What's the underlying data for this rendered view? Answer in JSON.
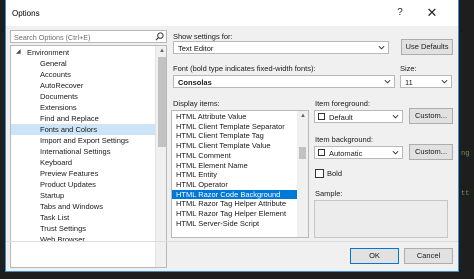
{
  "window": {
    "title": "Options",
    "help_glyph": "?",
    "close_glyph": "✕"
  },
  "background_fragments": [
    "ng",
    "tt"
  ],
  "search": {
    "placeholder": "Search Options (Ctrl+E)"
  },
  "tree": {
    "items": [
      {
        "label": "Environment",
        "expanded": true
      },
      {
        "label": "General"
      },
      {
        "label": "Accounts"
      },
      {
        "label": "AutoRecover"
      },
      {
        "label": "Documents"
      },
      {
        "label": "Extensions"
      },
      {
        "label": "Find and Replace"
      },
      {
        "label": "Fonts and Colors",
        "selected": true
      },
      {
        "label": "Import and Export Settings"
      },
      {
        "label": "International Settings"
      },
      {
        "label": "Keyboard"
      },
      {
        "label": "Preview Features"
      },
      {
        "label": "Product Updates"
      },
      {
        "label": "Startup"
      },
      {
        "label": "Tabs and Windows"
      },
      {
        "label": "Task List"
      },
      {
        "label": "Trust Settings"
      },
      {
        "label": "Web Browser"
      }
    ]
  },
  "settings": {
    "show_settings_label": "Show settings for:",
    "show_settings_value": "Text Editor",
    "use_defaults": "Use Defaults",
    "font_label": "Font (bold type indicates fixed-width fonts):",
    "font_value": "Consolas",
    "size_label": "Size:",
    "size_value": "11",
    "display_items_label": "Display items:",
    "display_items": [
      {
        "label": "HTML Attribute Value"
      },
      {
        "label": "HTML Client Template Separator"
      },
      {
        "label": "HTML Client Template Tag"
      },
      {
        "label": "HTML Client Template Value"
      },
      {
        "label": "HTML Comment"
      },
      {
        "label": "HTML Element Name"
      },
      {
        "label": "HTML Entity"
      },
      {
        "label": "HTML Operator"
      },
      {
        "label": "HTML Razor Code Background",
        "selected": true
      },
      {
        "label": "HTML Razor Tag Helper Attribute"
      },
      {
        "label": "HTML Razor Tag Helper Element"
      },
      {
        "label": "HTML Server-Side Script"
      }
    ],
    "item_foreground_label": "Item foreground:",
    "item_foreground_value": "Default",
    "custom_fg": "Custom...",
    "item_background_label": "Item background:",
    "item_background_value": "Automatic",
    "custom_bg": "Custom...",
    "bold_label": "Bold",
    "sample_label": "Sample:"
  },
  "footer": {
    "ok": "OK",
    "cancel": "Cancel"
  },
  "colors": {
    "accent": "#0078d7",
    "selection": "#cce4f7",
    "window_border": "#3c8dd6"
  },
  "icons": [
    "search-icon",
    "dropdown-arrow-icon",
    "expand-caret-icon",
    "help-icon",
    "close-icon"
  ]
}
